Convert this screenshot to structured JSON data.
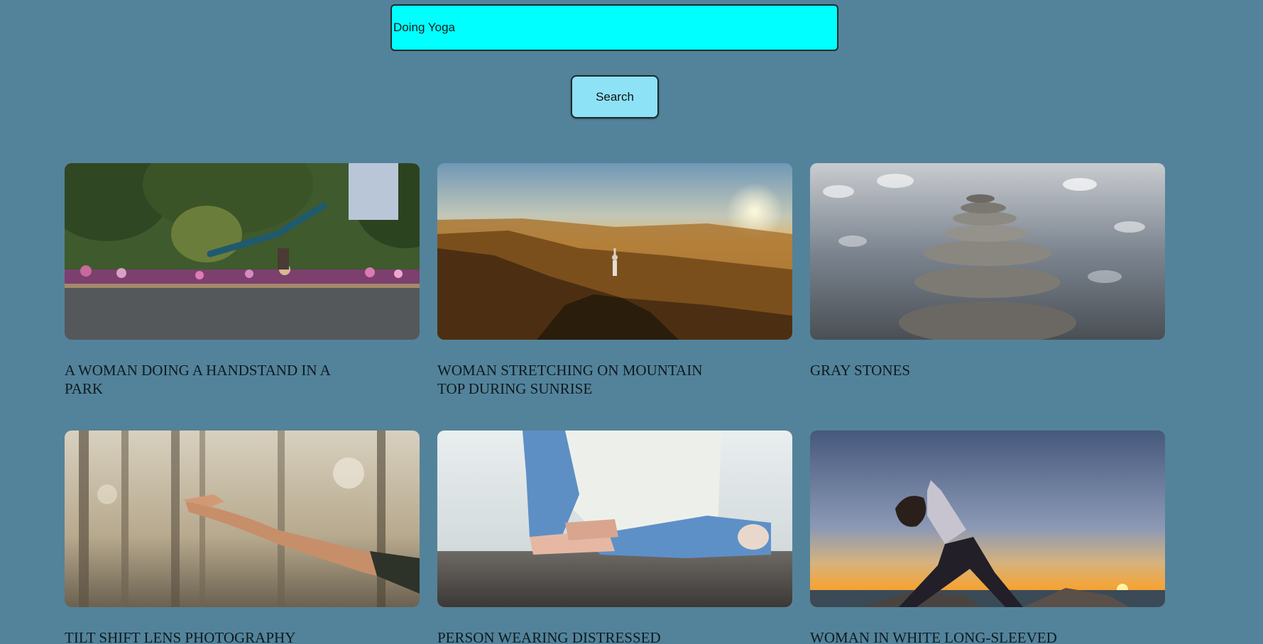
{
  "search": {
    "value": "Doing Yoga",
    "button_label": "Search"
  },
  "results": [
    {
      "caption": "A WOMAN DOING A HANDSTAND IN A PARK"
    },
    {
      "caption": "WOMAN STRETCHING ON MOUNTAIN TOP DURING SUNRISE"
    },
    {
      "caption": "GRAY STONES"
    },
    {
      "caption": "TILT SHIFT LENS PHOTOGRAPHY"
    },
    {
      "caption": "PERSON WEARING DISTRESSED"
    },
    {
      "caption": "WOMAN IN WHITE LONG-SLEEVED"
    }
  ],
  "colors": {
    "background": "#53839a",
    "input": "#00ffff",
    "button": "#8ee2f5"
  }
}
